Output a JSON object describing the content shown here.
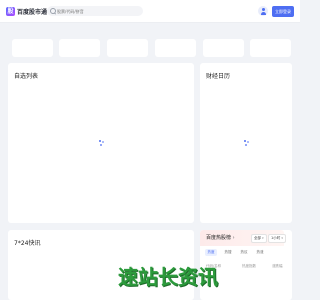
{
  "header": {
    "logo_text": "百度股市通",
    "search": {
      "placeholder": "股票/代码/拼音",
      "value": ""
    },
    "login_label": "立即登录"
  },
  "index_cards": [
    "",
    "",
    "",
    "",
    "",
    ""
  ],
  "panels": {
    "watchlist_title": "自选列表",
    "calendar_title": "财经日历",
    "news_title": "7*24快讯"
  },
  "hot_list": {
    "title": "百度热股榜",
    "market_select": "全部",
    "period_select": "1小时",
    "tabs": [
      "热度",
      "热搜",
      "热议",
      "热涨"
    ],
    "active_tab": 0,
    "columns": [
      "代码/名称",
      "热度指数",
      "涨跌幅"
    ]
  },
  "watermark_text": "速站长资讯",
  "colors": {
    "accent": "#4e6ef2",
    "page_bg": "#f1f3f7",
    "card_bg": "#ffffff",
    "watermark": "#2c9b3c"
  },
  "icons": {
    "search": "search-icon",
    "avatar": "user-avatar-icon",
    "loading": "loading-spinner-icon",
    "chevron": "chevron-right-icon"
  }
}
